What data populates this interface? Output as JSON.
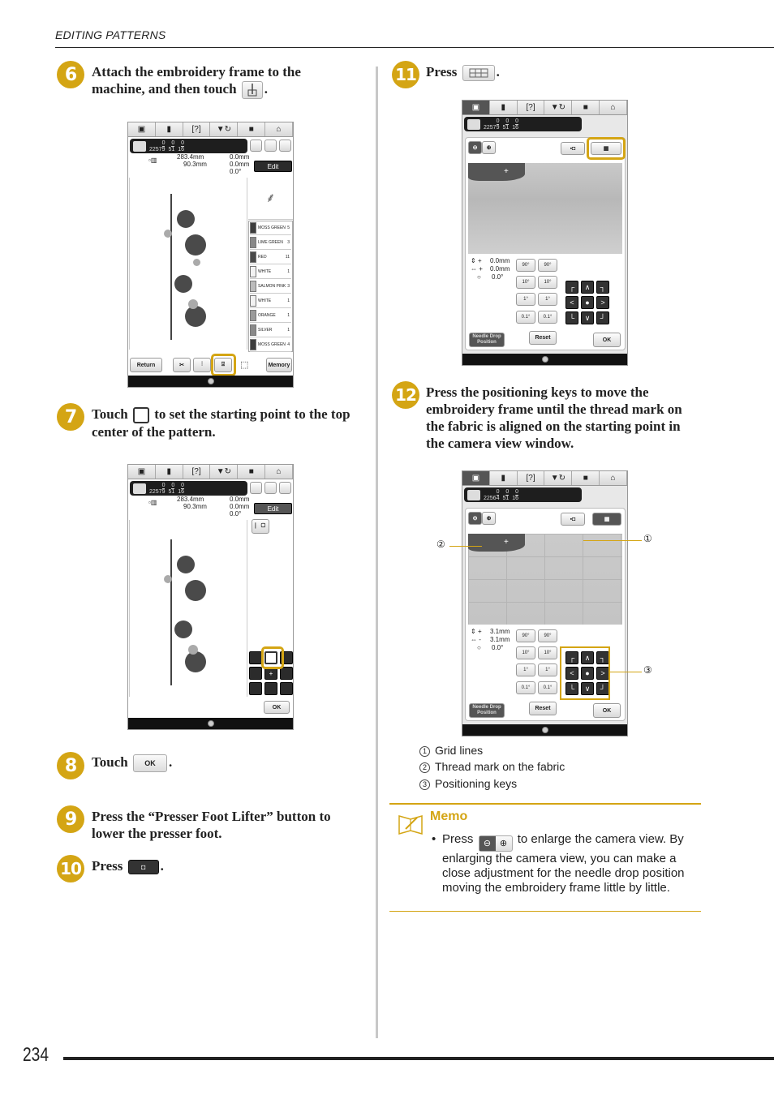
{
  "header": {
    "section_title": "EDITING PATTERNS"
  },
  "page_number": "234",
  "colors": {
    "accent": "#d4a514",
    "text": "#222222"
  },
  "steps": [
    {
      "num": "6",
      "text_a": "Attach the embroidery frame to the",
      "text_b": "machine, and then touch",
      "icon": "needle-start-icon"
    },
    {
      "num": "7",
      "text_a": "Touch",
      "text_b": "to set the starting point to the top",
      "text_c": "center of the pattern.",
      "icon": "top-center-frame-icon"
    },
    {
      "num": "8",
      "text_a": "Touch",
      "button_label": "OK"
    },
    {
      "num": "9",
      "text_a": "Press the “Presser Foot Lifter” button to",
      "text_b": "lower the presser foot."
    },
    {
      "num": "10",
      "text_a": "Press",
      "icon": "camera-icon"
    },
    {
      "num": "11",
      "text_a": "Press",
      "icon": "grid-icon"
    },
    {
      "num": "12",
      "text_a": "Press the positioning keys to move the",
      "text_b": "embroidery frame until the thread mark on",
      "text_c": "the fabric is aligned on the starting point in",
      "text_d": "the camera view window."
    }
  ],
  "screen_common": {
    "tabs": [
      "camera",
      "page",
      "help",
      "presser-foot",
      "lock",
      "home"
    ],
    "tab_glyphs": [
      "▣",
      "▮",
      "[?]",
      "▼↻",
      "■",
      "⌂"
    ],
    "min_unit": "min"
  },
  "screen1": {
    "stitch_top": "0",
    "stitch_total": "22579",
    "time_top": "0",
    "time_total": "51",
    "color_top": "0",
    "color_total": "16",
    "size_h": "283.4mm",
    "size_w": "90.3mm",
    "offset_v": "0.0mm",
    "offset_h": "0.0mm",
    "angle": "0.0°",
    "sign_v": "+",
    "sign_h": "+",
    "edit_label": "Edit",
    "threads": [
      {
        "name": "MOSS GREEN",
        "count": "5",
        "color": "#3d3d3d"
      },
      {
        "name": "LIME GREEN",
        "count": "3",
        "color": "#888888"
      },
      {
        "name": "RED",
        "count": "11",
        "color": "#4a4a4a"
      },
      {
        "name": "WHITE",
        "count": "1",
        "color": "#f2f2f2"
      },
      {
        "name": "SALMON PINK",
        "count": "3",
        "color": "#bbbbbb"
      },
      {
        "name": "WHITE",
        "count": "1",
        "color": "#f2f2f2"
      },
      {
        "name": "ORANGE",
        "count": "1",
        "color": "#9a9a9a"
      },
      {
        "name": "SILVER",
        "count": "1",
        "color": "#8a8a8a"
      },
      {
        "name": "MOSS GREEN",
        "count": "4",
        "color": "#3d3d3d"
      }
    ],
    "return_label": "Return",
    "memory_label": "Memory"
  },
  "screen2": {
    "stitch_top": "0",
    "stitch_total": "22579",
    "time_top": "0",
    "time_total": "51",
    "color_top": "0",
    "color_total": "16",
    "size_h": "283.4mm",
    "size_w": "90.3mm",
    "offset_v": "0.0mm",
    "offset_h": "0.0mm",
    "angle": "0.0°",
    "edit_label": "Edit",
    "ok_label": "OK"
  },
  "screen3": {
    "stitch_top": "0",
    "stitch_total": "22579",
    "time_top": "0",
    "time_total": "51",
    "color_top": "0",
    "color_total": "16",
    "offset_v": "0.0mm",
    "offset_h": "0.0mm",
    "angle": "0.0°",
    "sign_v": "+",
    "sign_h": "+",
    "rot_labels": [
      "90°",
      "90°",
      "10°",
      "10°",
      "1°",
      "1°",
      "0.1°",
      "0.1°"
    ],
    "needle_drop_label": "Needle Drop Position",
    "reset_label": "Reset",
    "ok_label": "OK"
  },
  "screen4": {
    "stitch_top": "0",
    "stitch_total": "22564",
    "time_top": "0",
    "time_total": "51",
    "color_top": "0",
    "color_total": "16",
    "offset_v": "3.1mm",
    "offset_h": "3.1mm",
    "angle": "0.0°",
    "sign_v": "+",
    "sign_h": "-",
    "rot_labels": [
      "90°",
      "90°",
      "10°",
      "10°",
      "1°",
      "1°",
      "0.1°",
      "0.1°"
    ],
    "needle_drop_label": "Needle Drop Position",
    "reset_label": "Reset",
    "ok_label": "OK"
  },
  "position_keys": [
    "┌",
    "∧",
    "┐",
    "<",
    "●",
    ">",
    "└",
    "∨",
    "┘"
  ],
  "callouts": {
    "c1": "①",
    "c2": "②",
    "c3": "③"
  },
  "legend": [
    {
      "num": "1",
      "label": "Grid lines"
    },
    {
      "num": "2",
      "label": "Thread mark on the fabric"
    },
    {
      "num": "3",
      "label": "Positioning keys"
    }
  ],
  "memo": {
    "title": "Memo",
    "bullet": "•",
    "text_a": "Press",
    "text_b": "to enlarge the camera view. By enlarging the camera view, you can make a close adjustment for the needle drop position moving the embroidery frame little by little."
  }
}
